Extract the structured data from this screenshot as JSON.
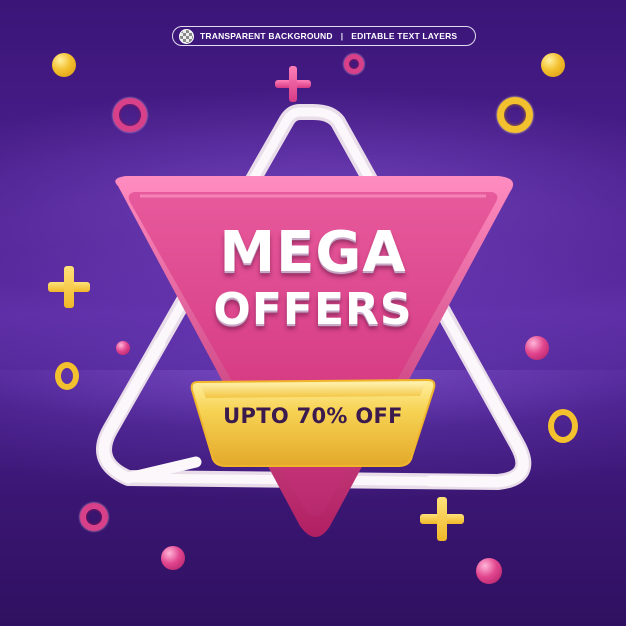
{
  "badge": {
    "left_text": "TRANSPARENT BACKGROUND",
    "separator": "|",
    "right_text": "EDITABLE TEXT LAYERS"
  },
  "headline": {
    "line1": "MEGA",
    "line2": "OFFERS"
  },
  "offer": {
    "text": "UPTO 70% OFF"
  },
  "colors": {
    "background": "#4a1f8c",
    "triangle_pink": "#e0498c",
    "outline_white": "#f4eef6",
    "ribbon_yellow": "#f6cb45",
    "offer_text": "#3b1a4e"
  }
}
